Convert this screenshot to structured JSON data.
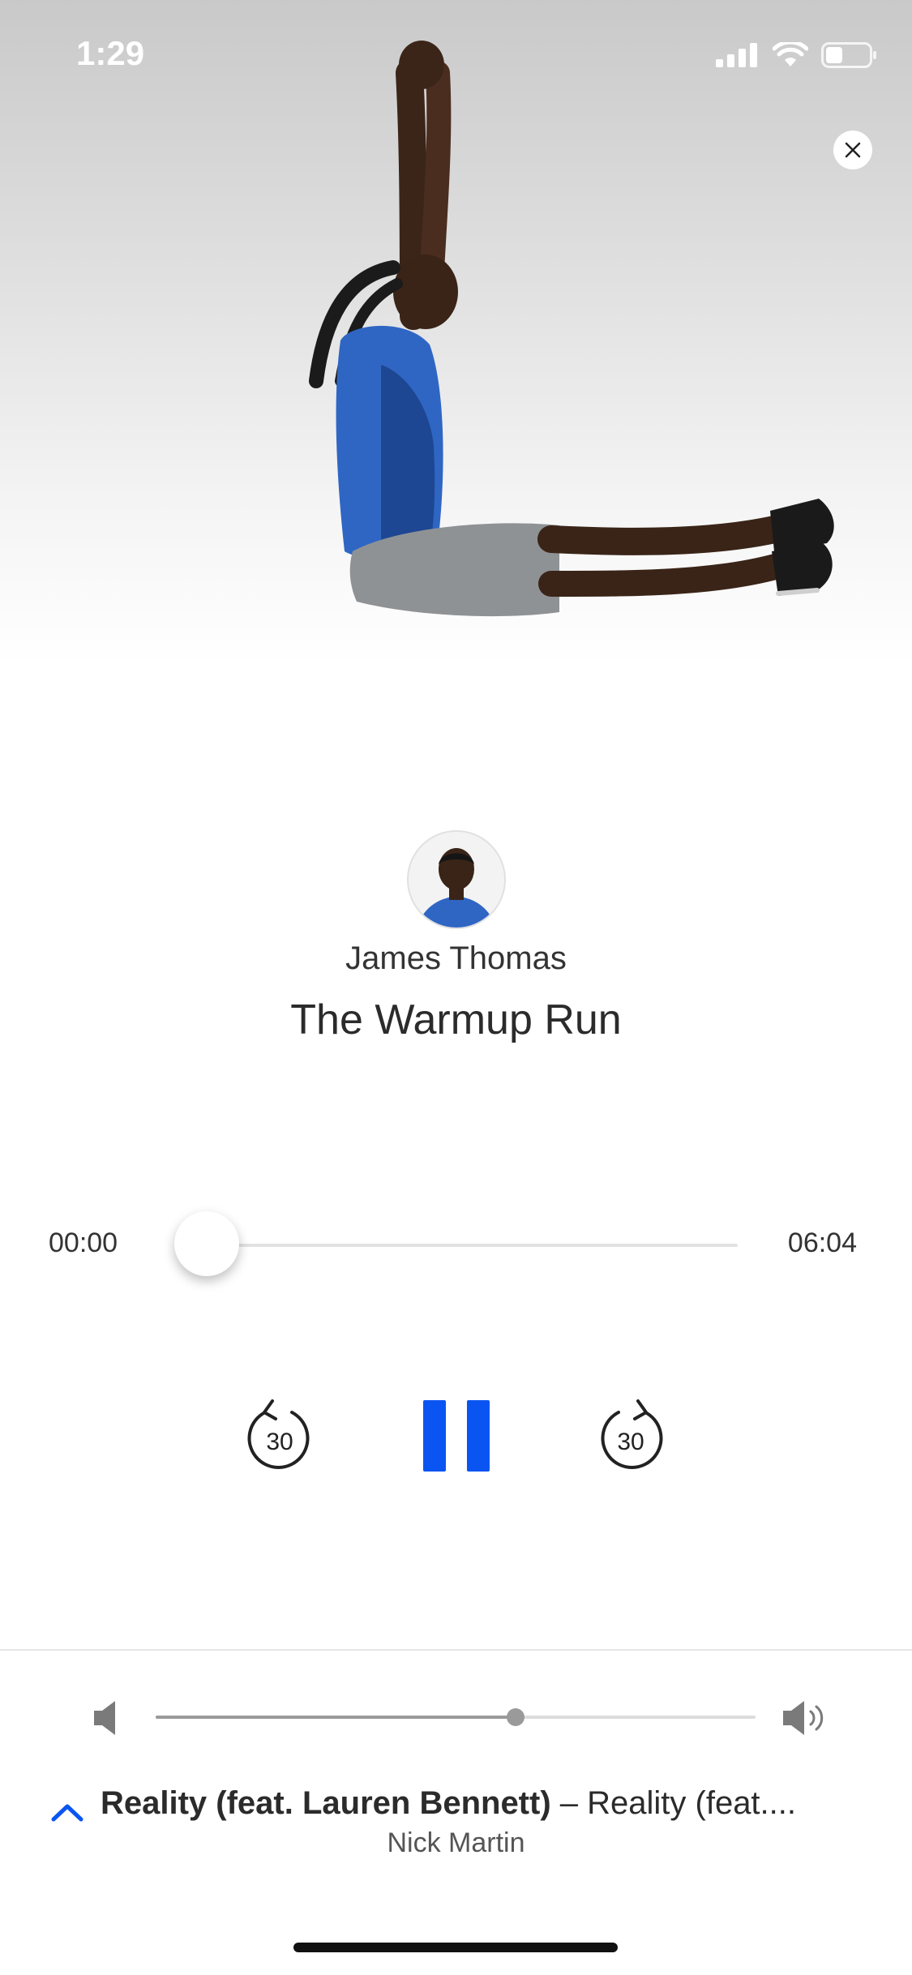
{
  "status_bar": {
    "time": "1:29"
  },
  "hero": {
    "close_icon": "close-icon"
  },
  "coach": {
    "name": "James Thomas"
  },
  "workout": {
    "title": "The Warmup Run"
  },
  "player": {
    "elapsed": "00:00",
    "total": "06:04",
    "progress": 0.0,
    "skip_back_label": "30",
    "skip_forward_label": "30",
    "accent_color": "#0a55f2"
  },
  "volume": {
    "level": 0.6
  },
  "now_playing": {
    "title": "Reality (feat. Lauren Bennett)",
    "subtitle": " – Reality (feat....",
    "artist": "Nick Martin"
  }
}
